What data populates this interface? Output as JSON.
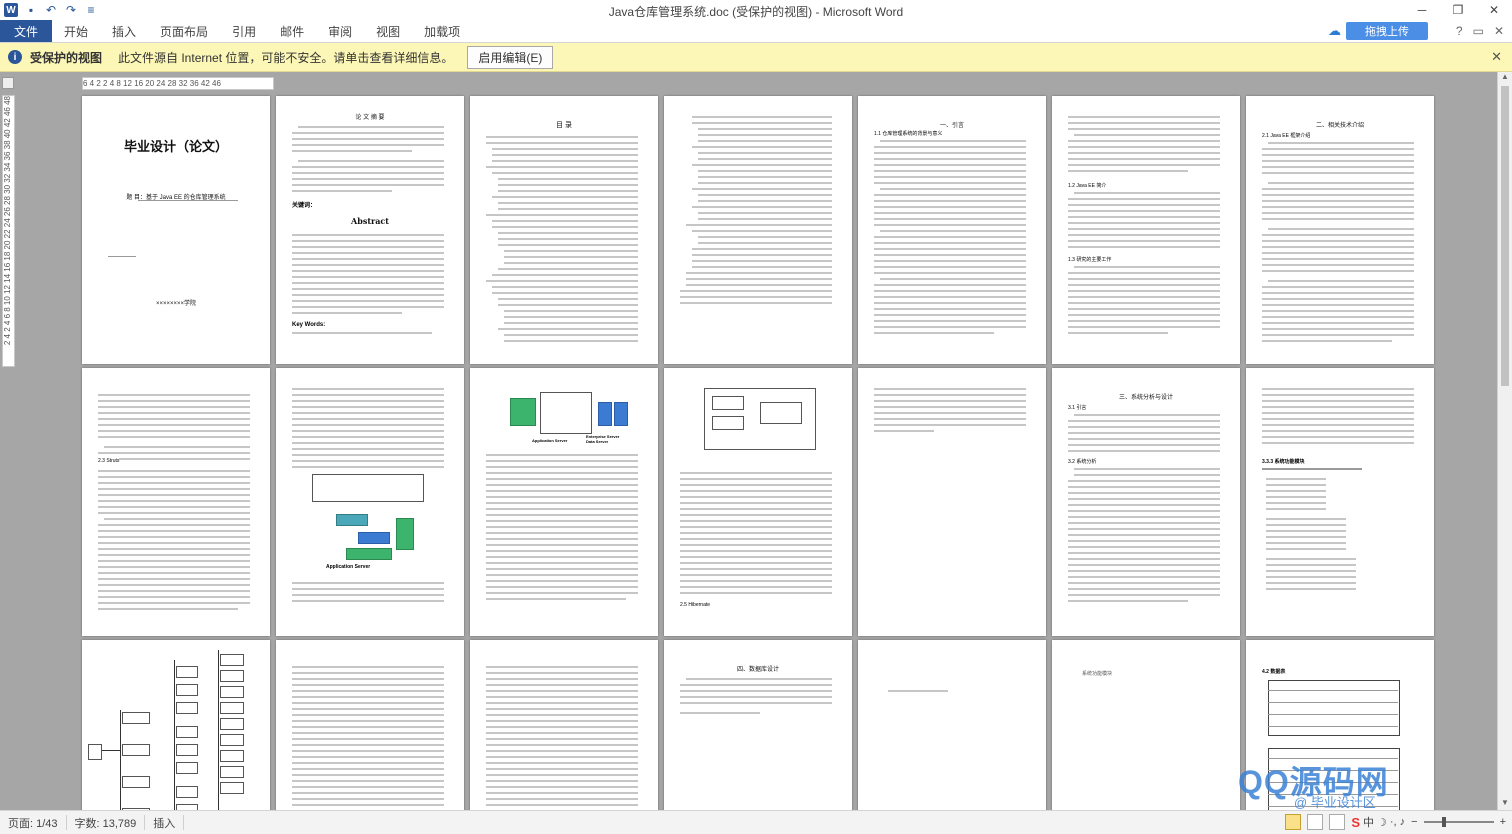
{
  "window": {
    "title": "Java仓库管理系统.doc (受保护的视图) - Microsoft Word",
    "controls": [
      "─",
      "❐",
      "✕"
    ]
  },
  "quick_access": {
    "app_icon": "W",
    "save": "▪",
    "undo": "↶",
    "redo": "↷",
    "customize": "≡"
  },
  "ribbon": {
    "tabs": [
      {
        "label": "文件"
      },
      {
        "label": "开始"
      },
      {
        "label": "插入"
      },
      {
        "label": "页面布局"
      },
      {
        "label": "引用"
      },
      {
        "label": "邮件"
      },
      {
        "label": "审阅"
      },
      {
        "label": "视图"
      },
      {
        "label": "加载项"
      }
    ],
    "upload_label": "拖拽上传",
    "right_icons": [
      "?",
      "▭",
      "✕"
    ]
  },
  "protected_view": {
    "title": "受保护的视图",
    "message": "此文件源自 Internet 位置，可能不安全。请单击查看详细信息。",
    "enable_button": "启用编辑(E)",
    "close": "✕"
  },
  "ruler": {
    "horizontal": "6  4  2    2  4  8  12 16 20 24 28 32 36  42 46",
    "vertical": "2 4 2 4 6 8 10 12 14 16 18 20 22 24 26 28 30 32 34 36 38 40 42 46 48"
  },
  "pages": {
    "cover_title": "毕业设计（论文）",
    "cover_subtitle": "题 目：基于 Java EE 的仓库管理系统",
    "cover_school": "××××××××学院",
    "abstract_heading": "论 文 摘 要",
    "abstract_en": "Abstract",
    "keywords": "关键词：",
    "keywords_en": "Key Words:",
    "toc_heading": "目 录",
    "ch1": "一、引言",
    "ch1_1": "1.1 仓库管理系统的背景与意义",
    "ch1_2": "1.2 Java EE 简介",
    "ch1_3": "1.3 研究的主要工作",
    "ch2": "二、相关技术介绍",
    "ch2_1": "2.1 Java EE 框架介绍",
    "ch3": "三、系统分析与设计",
    "ch3_1": "3.1 引言",
    "ch3_2": "3.2 系统分析",
    "ch4": "四、数据库设计",
    "ch4_2": "4.2 数据表",
    "fig_app_server": "Application Server",
    "fig_db_server": "Enterprise Server\nData Server",
    "fig_section": "2.3 Struts",
    "fig_overview": "2.5 Hibernate",
    "ch3_3": "3.3.3 系统功能模块",
    "blank_note": "系统功能模块"
  },
  "status": {
    "page": "页面: 1/43",
    "words": "字数: 13,789",
    "mode": "插入"
  },
  "watermark": {
    "brand": "QQ源码网",
    "slogan": "@ 毕业设计区"
  },
  "colors": {
    "ribbon_blue": "#2b579a",
    "pv_yellow": "#fcf7b6",
    "upload_blue": "#4a8ee6"
  }
}
